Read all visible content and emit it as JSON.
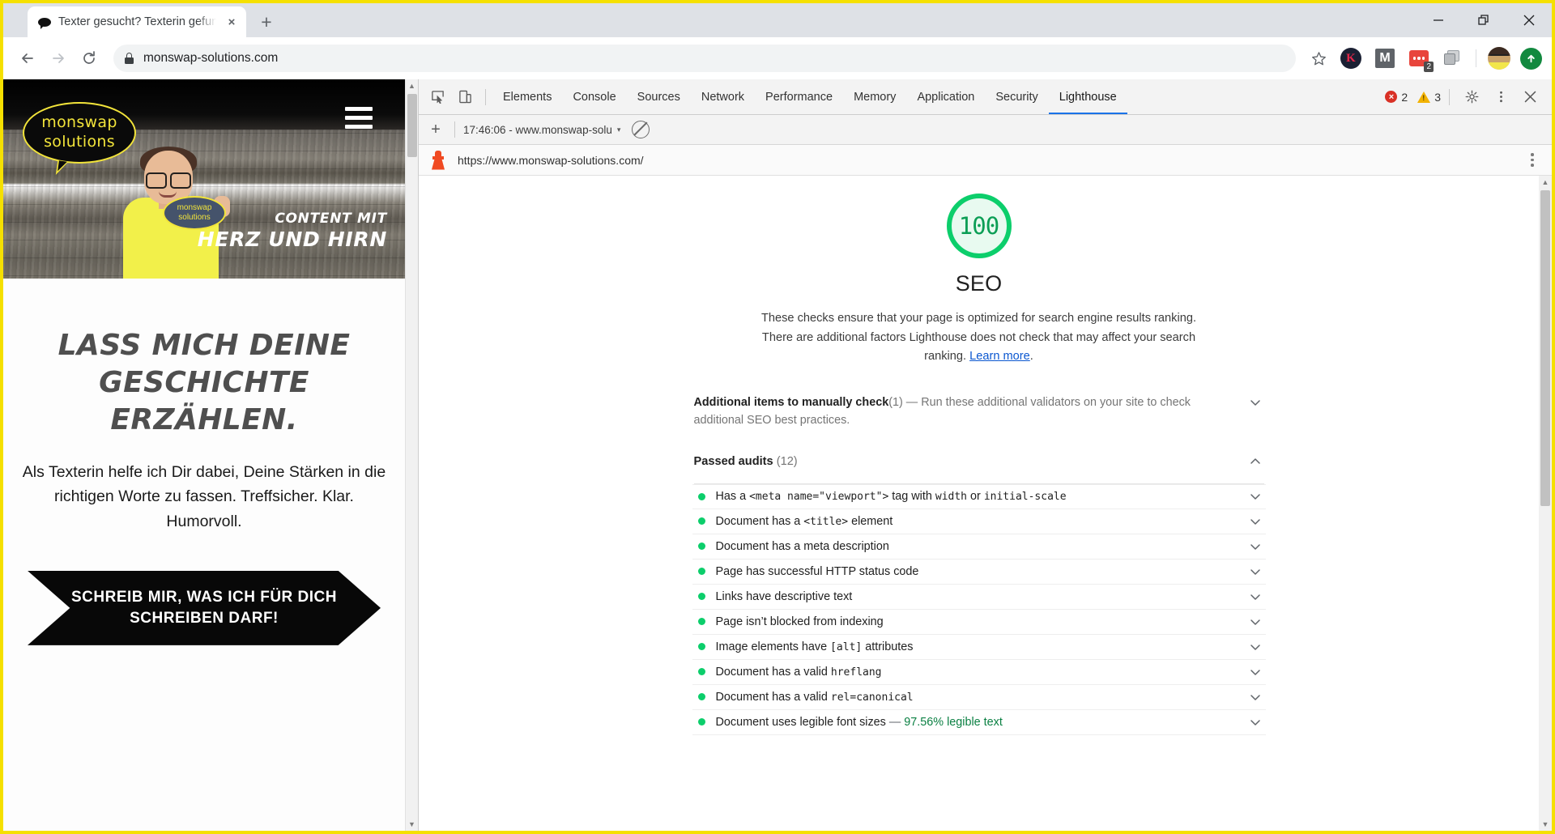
{
  "browser": {
    "tab": {
      "title": "Texter gesucht? Texterin gefunde",
      "favicon": "speech-bubble-icon",
      "close": "×"
    },
    "new_tab_label": "+",
    "window_controls": {
      "minimize": "minimize-icon",
      "restore": "restore-icon",
      "close": "close-icon"
    },
    "omnibox": {
      "url": "monswap-solutions.com",
      "lock": "lock-icon",
      "star": "bookmark-star-icon"
    },
    "extensions": [
      {
        "name": "extension-k",
        "label": "K"
      },
      {
        "name": "extension-gmail",
        "label": "M"
      },
      {
        "name": "extension-dots",
        "label": "",
        "badge": "2"
      },
      {
        "name": "extension-copy",
        "label": ""
      }
    ],
    "upload_icon": "upload-arrow-icon"
  },
  "site": {
    "logo": {
      "line1": "monswap",
      "line2": "solutions"
    },
    "menu": "hamburger-menu-icon",
    "sign": {
      "line1": "monswap",
      "line2": "solutions"
    },
    "hero_claim": {
      "line1": "CONTENT MIT",
      "line2": "HERZ UND HIRN"
    },
    "headline": "LASS MICH DEINE GESCHICHTE ERZÄHLEN.",
    "subtext": "Als Texterin helfe ich Dir dabei, Deine Stärken in die richtigen Worte zu fassen. Treffsicher. Klar. Humorvoll.",
    "cta": "SCHREIB MIR, WAS ICH FÜR DICH SCHREIBEN DARF!"
  },
  "devtools": {
    "tabs": [
      {
        "label": "Elements",
        "active": false
      },
      {
        "label": "Console",
        "active": false
      },
      {
        "label": "Sources",
        "active": false
      },
      {
        "label": "Network",
        "active": false
      },
      {
        "label": "Performance",
        "active": false
      },
      {
        "label": "Memory",
        "active": false
      },
      {
        "label": "Application",
        "active": false
      },
      {
        "label": "Security",
        "active": false
      },
      {
        "label": "Lighthouse",
        "active": true
      }
    ],
    "inspect_icon": "inspect-element-icon",
    "device_icon": "device-toolbar-icon",
    "errors": "2",
    "warnings": "3",
    "settings_icon": "gear-icon",
    "more_icon": "kebab-menu-icon",
    "close_icon": "close-icon"
  },
  "lighthouse": {
    "add_label": "+",
    "run_selector": "17:46:06 - www.monswap-solu",
    "caret": "▾",
    "clear_icon": "clear-all-icon",
    "report_url": "https://www.monswap-solutions.com/",
    "score": "100",
    "category": "SEO",
    "description": "These checks ensure that your page is optimized for search engine results ranking. There are additional factors Lighthouse does not check that may affect your search ranking. ",
    "learn_more": "Learn more",
    "description_end": ".",
    "manual": {
      "title": "Additional items to manually check",
      "count": "(1)",
      "dash": " — ",
      "body": "Run these additional validators on your site to check additional SEO best practices."
    },
    "passed": {
      "title": "Passed audits",
      "count": "(12)"
    },
    "audits": [
      {
        "parts": [
          {
            "t": "text",
            "v": "Has a "
          },
          {
            "t": "code",
            "v": "<meta name=\"viewport\">"
          },
          {
            "t": "text",
            "v": " tag with "
          },
          {
            "t": "code",
            "v": "width"
          },
          {
            "t": "text",
            "v": " or "
          },
          {
            "t": "code",
            "v": "initial-scale"
          }
        ]
      },
      {
        "parts": [
          {
            "t": "text",
            "v": "Document has a "
          },
          {
            "t": "code",
            "v": "<title>"
          },
          {
            "t": "text",
            "v": " element"
          }
        ]
      },
      {
        "parts": [
          {
            "t": "text",
            "v": "Document has a meta description"
          }
        ]
      },
      {
        "parts": [
          {
            "t": "text",
            "v": "Page has successful HTTP status code"
          }
        ]
      },
      {
        "parts": [
          {
            "t": "text",
            "v": "Links have descriptive text"
          }
        ]
      },
      {
        "parts": [
          {
            "t": "text",
            "v": "Page isn’t blocked from indexing"
          }
        ]
      },
      {
        "parts": [
          {
            "t": "text",
            "v": "Image elements have "
          },
          {
            "t": "code",
            "v": "[alt]"
          },
          {
            "t": "text",
            "v": " attributes"
          }
        ]
      },
      {
        "parts": [
          {
            "t": "text",
            "v": "Document has a valid "
          },
          {
            "t": "code",
            "v": "hreflang"
          }
        ]
      },
      {
        "parts": [
          {
            "t": "text",
            "v": "Document has a valid "
          },
          {
            "t": "code",
            "v": "rel=canonical"
          }
        ]
      },
      {
        "parts": [
          {
            "t": "text",
            "v": "Document uses legible font sizes"
          },
          {
            "t": "dash",
            "v": "  —  "
          },
          {
            "t": "value",
            "v": "97.56% legible text"
          }
        ]
      }
    ]
  },
  "colors": {
    "accent_green": "#0cce6b",
    "brand_yellow": "#f2e43a",
    "devtools_blue": "#1a73e8",
    "error_red": "#d93025",
    "warn_yellow": "#f2b200"
  }
}
